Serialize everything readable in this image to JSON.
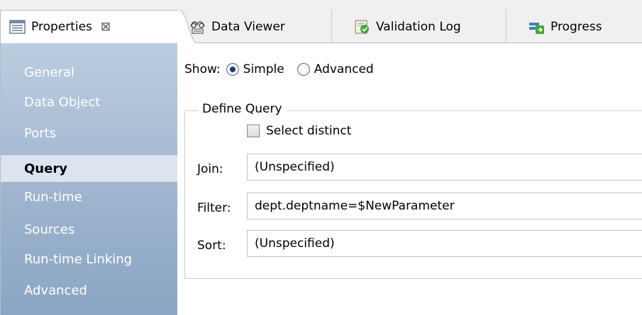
{
  "tabs": [
    {
      "label": "Properties",
      "icon": "properties-icon",
      "close_glyph": "⊠",
      "active": true
    },
    {
      "label": "Data Viewer",
      "icon": "data-viewer-icon",
      "active": false
    },
    {
      "label": "Validation Log",
      "icon": "validation-log-icon",
      "active": false
    },
    {
      "label": "Progress",
      "icon": "progress-icon",
      "active": false
    }
  ],
  "sidebar": {
    "items": [
      {
        "label": "General"
      },
      {
        "label": "Data Object"
      },
      {
        "label": "Ports"
      },
      {
        "label": "Query",
        "selected": true
      },
      {
        "label": "Run-time"
      },
      {
        "label": "Sources"
      },
      {
        "label": "Run-time Linking"
      },
      {
        "label": "Advanced"
      }
    ]
  },
  "show": {
    "label": "Show:",
    "options": [
      {
        "label": "Simple",
        "checked": true
      },
      {
        "label": "Advanced",
        "checked": false
      }
    ]
  },
  "define_query": {
    "title": "Define Query",
    "select_distinct": {
      "label": "Select distinct",
      "checked": false
    },
    "join": {
      "label": "Join:",
      "value": "(Unspecified)"
    },
    "filter": {
      "label": "Filter:",
      "value": "dept.deptname=$NewParameter"
    },
    "sort": {
      "label": "Sort:",
      "value": "(Unspecified)"
    }
  },
  "colors": {
    "sidebar_top": "#bccde0",
    "sidebar_bottom": "#8aa6c4",
    "selected_item_bg": "#dbe4ef",
    "radio_dot": "#1d3e78"
  }
}
